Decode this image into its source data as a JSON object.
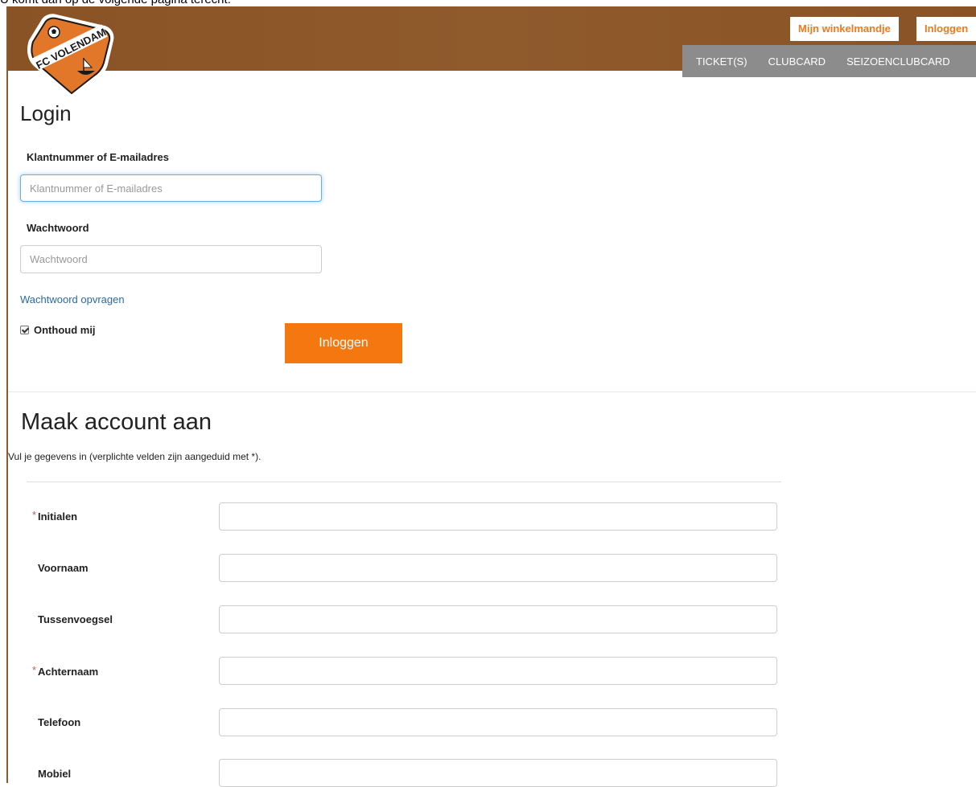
{
  "caption": "U komt dan op de volgende pagina terecht:",
  "header": {
    "logo_text": "FC VOLENDAM",
    "cart_label": "Mijn winkelmandje",
    "login_label": "Inloggen",
    "nav": [
      "TICKET(S)",
      "CLUBCARD",
      "SEIZOENCLUBCARD"
    ]
  },
  "login": {
    "title": "Login",
    "username_label": "Klantnummer of E-mailadres",
    "username_placeholder": "Klantnummer of E-mailadres",
    "password_label": "Wachtwoord",
    "password_placeholder": "Wachtwoord",
    "forgot_link": "Wachtwoord opvragen",
    "remember_label": "Onthoud mij",
    "remember_checked": true,
    "submit_label": "Inloggen"
  },
  "register": {
    "title": "Maak account aan",
    "subtitle": "Vul je gegevens in (verplichte velden zijn aangeduid met *).",
    "required_mark": "*",
    "fields": [
      {
        "label": "Initialen",
        "required": true
      },
      {
        "label": "Voornaam",
        "required": false
      },
      {
        "label": "Tussenvoegsel",
        "required": false
      },
      {
        "label": "Achternaam",
        "required": true
      },
      {
        "label": "Telefoon",
        "required": false
      },
      {
        "label": "Mobiel",
        "required": false
      }
    ]
  },
  "colors": {
    "brand_brown": "#8a5326",
    "accent_orange": "#f4780f",
    "nav_grey": "#8c8c8c",
    "link_blue": "#2a6aa5"
  }
}
